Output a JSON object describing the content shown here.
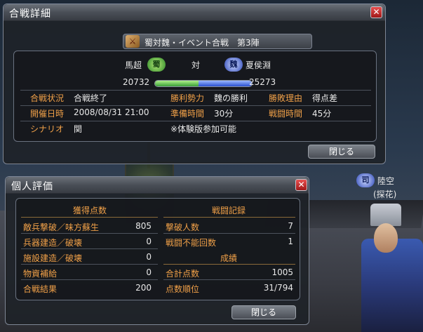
{
  "colors": {
    "accent_orange": "#f0a048",
    "shu_green": "#3aa038",
    "wei_blue": "#2a50d0",
    "close_red": "#c02020"
  },
  "battle_window": {
    "title": "合戦詳細",
    "close_icon": "close-icon",
    "header": {
      "icon": "crossed-swords-icon",
      "text": "蜀対魏・イベント合戦　第3陣"
    },
    "left_general": {
      "name": "馬超",
      "faction": "蜀",
      "score": "20732"
    },
    "versus": "対",
    "right_general": {
      "name": "夏侯淵",
      "faction": "魏",
      "score": "25273"
    },
    "score_bar": {
      "left_fraction": 0.45,
      "right_fraction": 0.55
    },
    "info": {
      "status_label": "合戦状況",
      "status_value": "合戦終了",
      "winner_label": "勝利勢力",
      "winner_value": "魏の勝利",
      "reason_label": "勝敗理由",
      "reason_value": "得点差",
      "date_label": "開催日時",
      "date_value": "2008/08/31  21:00",
      "prep_label": "準備時間",
      "prep_value": "30分",
      "battle_time_label": "戦闘時間",
      "battle_time_value": "45分",
      "scenario_label": "シナリオ",
      "scenario_value": "関",
      "note": "※体験版参加可能"
    },
    "close_button": "閉じる"
  },
  "personal_window": {
    "title": "個人評価",
    "close_icon": "close-icon",
    "points_header": "獲得点数",
    "records_header": "戦闘記録",
    "points": [
      {
        "label": "敵兵撃破／味方蘇生",
        "value": "805"
      },
      {
        "label": "兵器建造／破壊",
        "value": "0"
      },
      {
        "label": "施設建造／破壊",
        "value": "0"
      },
      {
        "label": "物資補給",
        "value": "0"
      },
      {
        "label": "合戦結果",
        "value": "200"
      }
    ],
    "records": [
      {
        "label": "撃破人数",
        "value": "7"
      },
      {
        "label": "戦闘不能回数",
        "value": "1"
      }
    ],
    "results_header": "成績",
    "results": [
      {
        "label": "合計点数",
        "value": "1005"
      },
      {
        "label": "点数順位",
        "value": "31/794"
      }
    ],
    "close_button": "閉じる"
  },
  "player": {
    "faction": "司",
    "name": "陸空",
    "title": "(探花)"
  }
}
